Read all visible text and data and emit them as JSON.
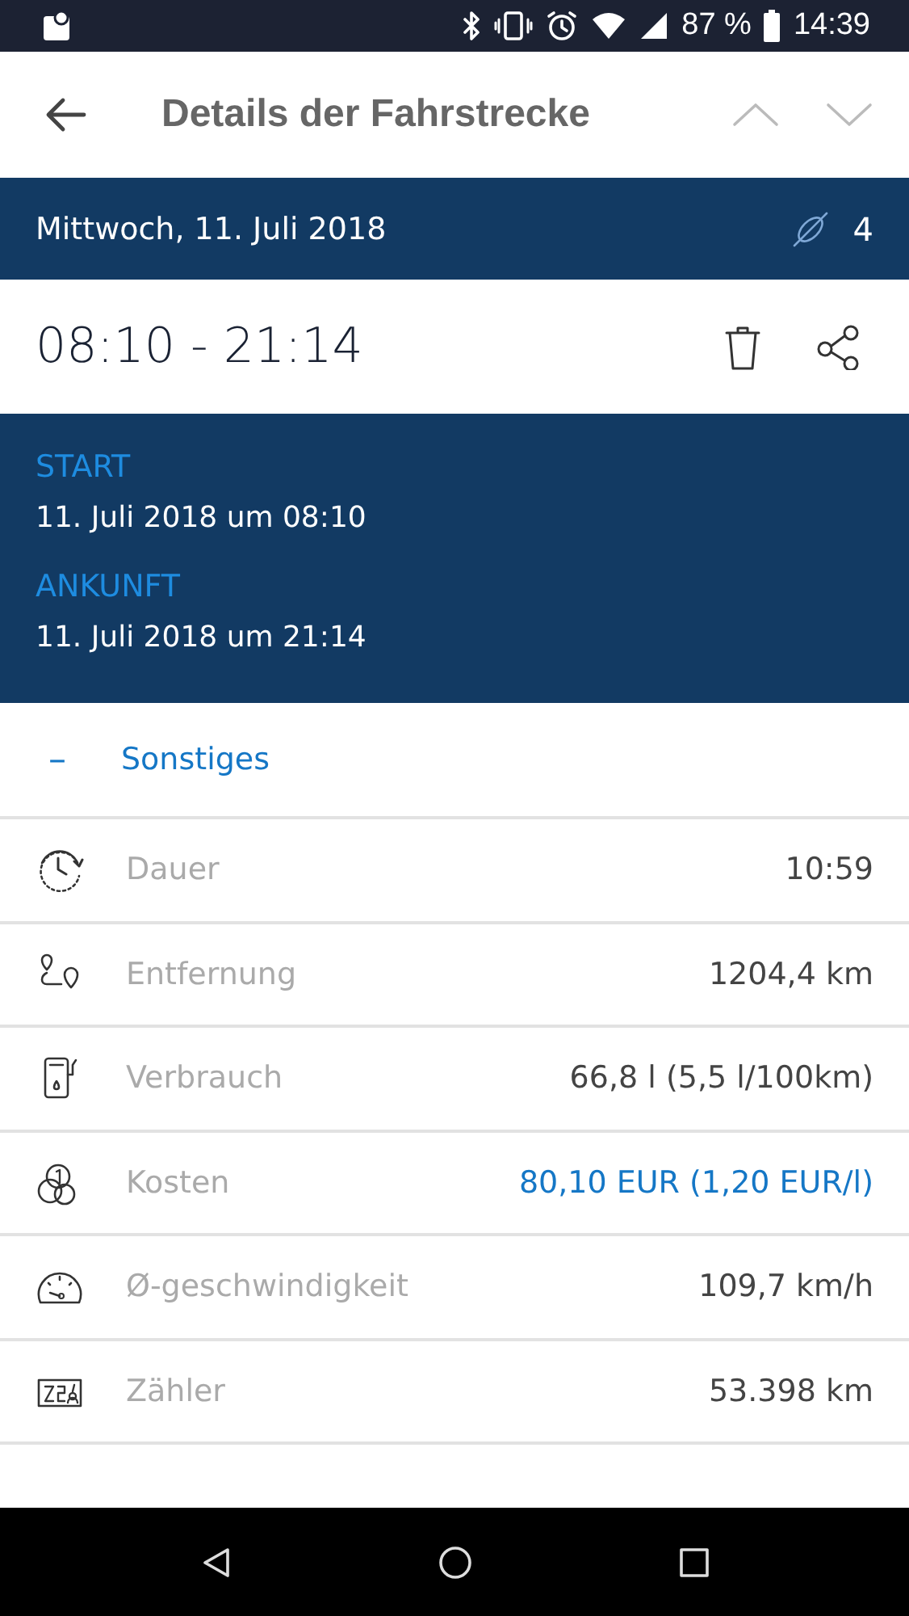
{
  "status_bar": {
    "battery": "87 %",
    "time": "14:39"
  },
  "toolbar": {
    "title": "Details der Fahrstrecke"
  },
  "date_bar": {
    "date": "Mittwoch, 11. Juli 2018",
    "count": "4"
  },
  "time_row": {
    "range": "08:10 - 21:14"
  },
  "trip": [
    {
      "label": "START",
      "value": "11. Juli 2018 um 08:10"
    },
    {
      "label": "ANKUNFT",
      "value": "11. Juli 2018 um 21:14"
    }
  ],
  "section": {
    "toggle": "–",
    "title": "Sonstiges",
    "expanded": true
  },
  "rows": [
    {
      "kind": "duration",
      "label": "Dauer",
      "value": "10:59",
      "link": false
    },
    {
      "kind": "distance",
      "label": "Entfernung",
      "value": "1204,4 km",
      "link": false
    },
    {
      "kind": "fuel",
      "label": "Verbrauch",
      "value": "66,8 l (5,5 l/100km)",
      "link": false
    },
    {
      "kind": "cost",
      "label": "Kosten",
      "value": "80,10 EUR (1,20 EUR/l)",
      "link": true
    },
    {
      "kind": "speed",
      "label": "Ø-geschwindigkeit",
      "value": "109,7 km/h",
      "link": false
    },
    {
      "kind": "odometer",
      "label": "Zähler",
      "value": "53.398 km",
      "link": false
    }
  ]
}
